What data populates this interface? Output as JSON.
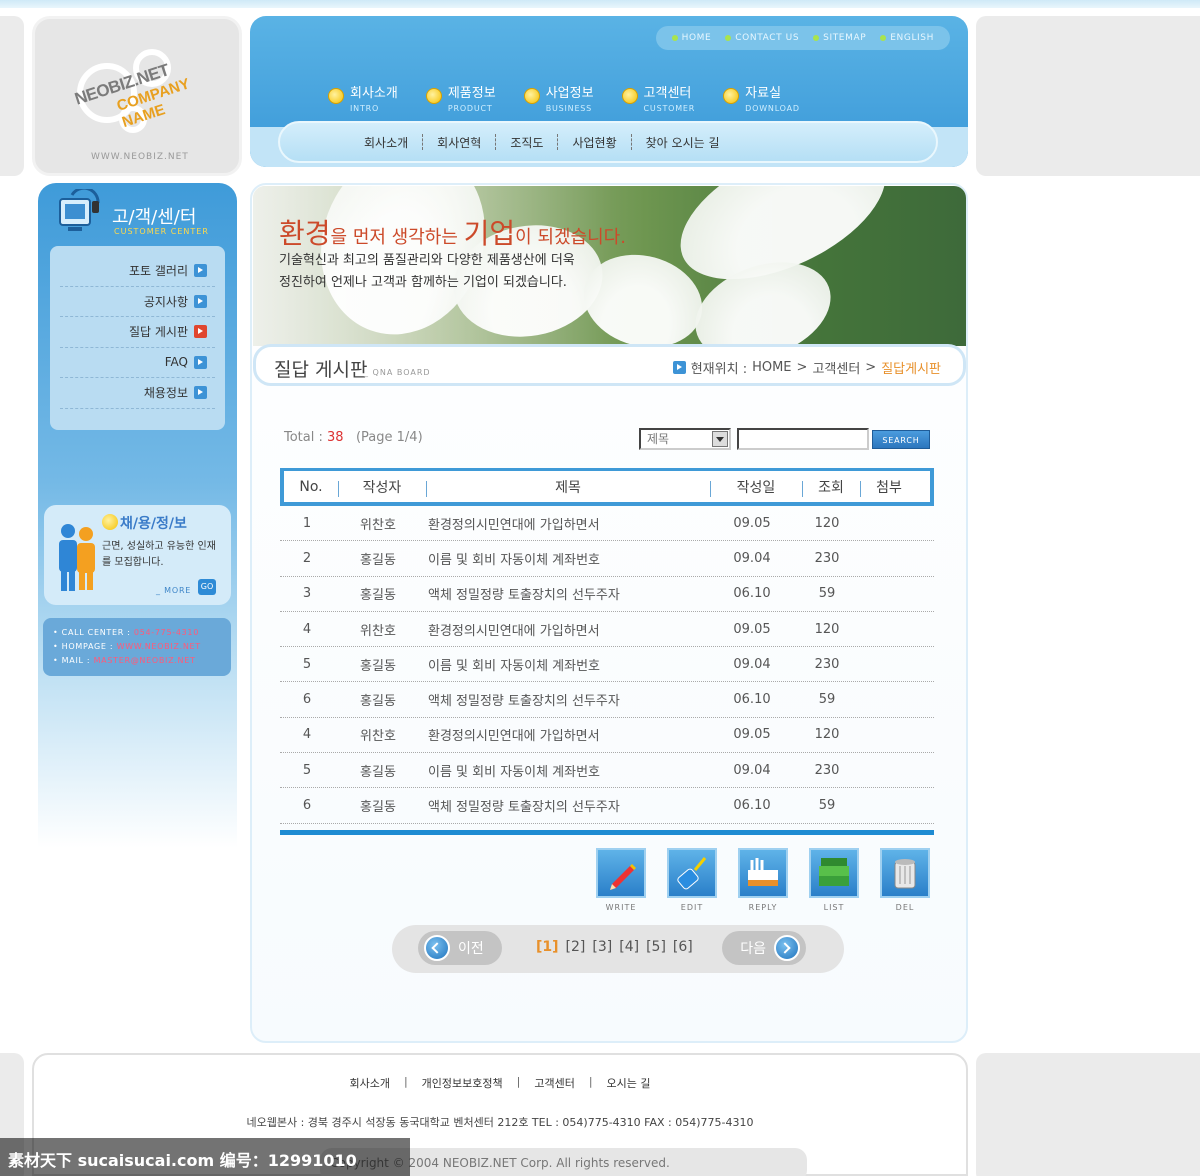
{
  "logo": {
    "brand": "NEOBIZ.NET",
    "company": "COMPANY NAME",
    "url": "WWW.NEOBIZ.NET"
  },
  "topnav": [
    {
      "label": "HOME"
    },
    {
      "label": "CONTACT US"
    },
    {
      "label": "SITEMAP"
    },
    {
      "label": "ENGLISH"
    }
  ],
  "mainnav": [
    {
      "label": "회사소개",
      "sub": "INTRO"
    },
    {
      "label": "제품정보",
      "sub": "PRODUCT"
    },
    {
      "label": "사업정보",
      "sub": "BUSINESS"
    },
    {
      "label": "고객센터",
      "sub": "CUSTOMER"
    },
    {
      "label": "자료실",
      "sub": "DOWNLOAD"
    }
  ],
  "subnav": [
    {
      "label": "회사소개"
    },
    {
      "label": "회사연혁"
    },
    {
      "label": "조직도"
    },
    {
      "label": "사업현황"
    },
    {
      "label": "찾아 오시는 길"
    }
  ],
  "sidebar": {
    "title": "고/객/센/터",
    "subtitle": "CUSTOMER CENTER",
    "items": [
      {
        "label": "포토 갤러리",
        "active": false
      },
      {
        "label": "공지사항",
        "active": false
      },
      {
        "label": "질답 게시판",
        "active": true
      },
      {
        "label": "FAQ",
        "active": false
      },
      {
        "label": "채용정보",
        "active": false
      }
    ],
    "recruit": {
      "title": "채/용/정/보",
      "text": "근면, 성실하고 유능한 인재를 모집합니다.",
      "more": "_ MORE",
      "go": "GO"
    },
    "contact": {
      "call_label": "CALL CENTER :",
      "call_value": "054-775-4310",
      "home_label": "HOMPAGE :",
      "home_value": "WWW.NEOBIZ.NET",
      "mail_label": "MAIL :",
      "mail_value": "MASTER@NEOBIZ.NET"
    }
  },
  "banner": {
    "title_big1": "환경",
    "title_mid1": "을 먼저 생각하는 ",
    "title_big2": "기업",
    "title_mid2": "이 되겠습니다.",
    "line1": "기술혁신과 최고의 품질관리와 다양한 제품생산에 더욱",
    "line2": "정진하여 언제나 고객과 함께하는 기업이 되겠습니다."
  },
  "board": {
    "title": "질답 게시판",
    "subtitle": "_ QNA BOARD",
    "breadcrumb_label": "현재위치 :",
    "breadcrumb": [
      "HOME",
      "고객센터",
      "질답게시판"
    ],
    "total_label": "Total :",
    "total": "38",
    "page_info": "(Page 1/4)",
    "search_field": "제목",
    "search_value": "",
    "search_button": "SEARCH",
    "columns": [
      "No.",
      "작성자",
      "제목",
      "작성일",
      "조회",
      "첨부"
    ],
    "rows": [
      {
        "no": "1",
        "author": "위찬호",
        "subject": "환경정의시민연대에 가입하면서",
        "date": "09.05",
        "views": "120"
      },
      {
        "no": "2",
        "author": "홍길동",
        "subject": "이름 및 회비 자동이체 계좌번호",
        "date": "09.04",
        "views": "230"
      },
      {
        "no": "3",
        "author": "홍길동",
        "subject": "액체 정밀정량 토출장치의 선두주자",
        "date": "06.10",
        "views": "59"
      },
      {
        "no": "4",
        "author": "위찬호",
        "subject": "환경정의시민연대에 가입하면서",
        "date": "09.05",
        "views": "120"
      },
      {
        "no": "5",
        "author": "홍길동",
        "subject": "이름 및 회비 자동이체 계좌번호",
        "date": "09.04",
        "views": "230"
      },
      {
        "no": "6",
        "author": "홍길동",
        "subject": "액체 정밀정량 토출장치의 선두주자",
        "date": "06.10",
        "views": "59"
      },
      {
        "no": "4",
        "author": "위찬호",
        "subject": "환경정의시민연대에 가입하면서",
        "date": "09.05",
        "views": "120"
      },
      {
        "no": "5",
        "author": "홍길동",
        "subject": "이름 및 회비 자동이체 계좌번호",
        "date": "09.04",
        "views": "230"
      },
      {
        "no": "6",
        "author": "홍길동",
        "subject": "액체 정밀정량 토출장치의 선두주자",
        "date": "06.10",
        "views": "59"
      }
    ],
    "actions": [
      {
        "label": "WRITE",
        "icon": "pencil-icon"
      },
      {
        "label": "EDIT",
        "icon": "paint-roller-icon"
      },
      {
        "label": "REPLY",
        "icon": "reply-icon"
      },
      {
        "label": "LIST",
        "icon": "books-icon"
      },
      {
        "label": "DEL",
        "icon": "trash-icon"
      }
    ],
    "pager": {
      "prev": "이전",
      "next": "다음",
      "pages": [
        "[1]",
        "[2]",
        "[3]",
        "[4]",
        "[5]",
        "[6]"
      ],
      "current": "[1]"
    }
  },
  "footer": {
    "links": [
      "회사소개",
      "개인정보보호정책",
      "고객센터",
      "오시는 길"
    ],
    "address": "네오웹본사 : 경북 경주시 석장동 동국대학교 벤처센터 212호  TEL : 054)775-4310   FAX : 054)775-4310",
    "copyright": "Copyright © 2004 NEOBIZ.NET Corp. All rights reserved."
  },
  "watermark": "素材天下 sucaisucai.com  编号：12991010",
  "colors": {
    "accent": "#3a98d8",
    "highlight": "#e8902a",
    "title_red": "#cc4a2a",
    "count_red": "#dd3333"
  }
}
